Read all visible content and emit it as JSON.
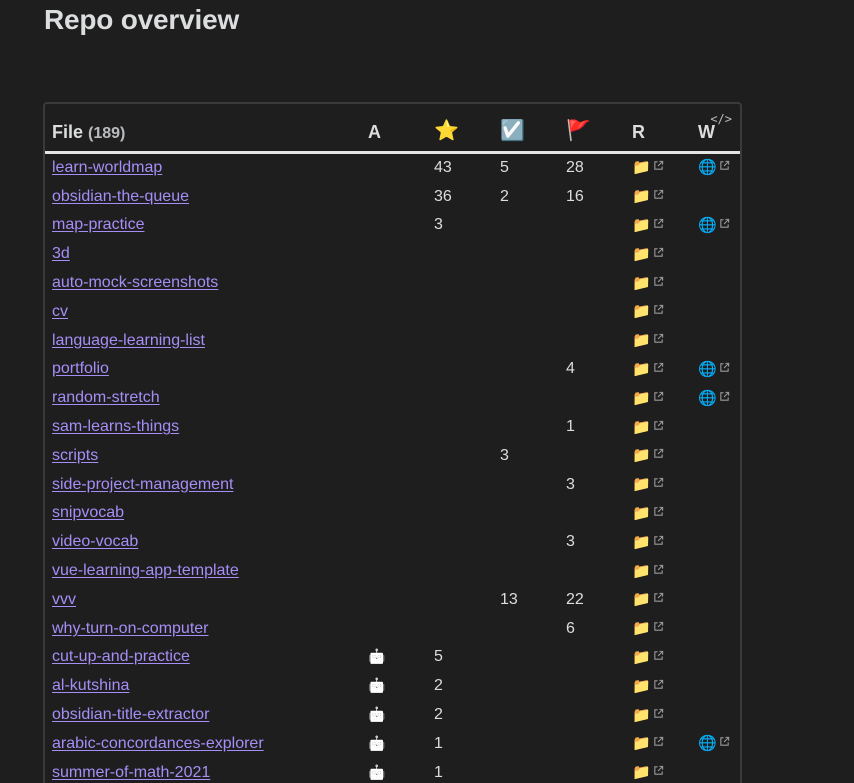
{
  "page": {
    "title": "Repo overview",
    "code_toggle": "</>"
  },
  "table": {
    "headers": {
      "file": "File",
      "file_count": "(189)",
      "archived": "A",
      "stars": "⭐",
      "todos": "☑️",
      "issues": "🚩",
      "repo": "R",
      "website": "W"
    },
    "icons": {
      "folder": "📁",
      "globe": "🌐",
      "bot": "🤖"
    },
    "rows": [
      {
        "name": "learn-worldmap",
        "archived": "",
        "stars": "43",
        "todos": "5",
        "issues": "28",
        "repo": true,
        "web": true
      },
      {
        "name": "obsidian-the-queue",
        "archived": "",
        "stars": "36",
        "todos": "2",
        "issues": "16",
        "repo": true,
        "web": false
      },
      {
        "name": "map-practice",
        "archived": "",
        "stars": "3",
        "todos": "",
        "issues": "",
        "repo": true,
        "web": true
      },
      {
        "name": "3d",
        "archived": "",
        "stars": "",
        "todos": "",
        "issues": "",
        "repo": true,
        "web": false
      },
      {
        "name": "auto-mock-screenshots",
        "archived": "",
        "stars": "",
        "todos": "",
        "issues": "",
        "repo": true,
        "web": false
      },
      {
        "name": "cv",
        "archived": "",
        "stars": "",
        "todos": "",
        "issues": "",
        "repo": true,
        "web": false
      },
      {
        "name": "language-learning-list",
        "archived": "",
        "stars": "",
        "todos": "",
        "issues": "",
        "repo": true,
        "web": false
      },
      {
        "name": "portfolio",
        "archived": "",
        "stars": "",
        "todos": "",
        "issues": "4",
        "repo": true,
        "web": true
      },
      {
        "name": "random-stretch",
        "archived": "",
        "stars": "",
        "todos": "",
        "issues": "",
        "repo": true,
        "web": true
      },
      {
        "name": "sam-learns-things",
        "archived": "",
        "stars": "",
        "todos": "",
        "issues": "1",
        "repo": true,
        "web": false
      },
      {
        "name": "scripts",
        "archived": "",
        "stars": "",
        "todos": "3",
        "issues": "",
        "repo": true,
        "web": false
      },
      {
        "name": "side-project-management",
        "archived": "",
        "stars": "",
        "todos": "",
        "issues": "3",
        "repo": true,
        "web": false
      },
      {
        "name": "snipvocab",
        "archived": "",
        "stars": "",
        "todos": "",
        "issues": "",
        "repo": true,
        "web": false
      },
      {
        "name": "video-vocab",
        "archived": "",
        "stars": "",
        "todos": "",
        "issues": "3",
        "repo": true,
        "web": false
      },
      {
        "name": "vue-learning-app-template",
        "archived": "",
        "stars": "",
        "todos": "",
        "issues": "",
        "repo": true,
        "web": false
      },
      {
        "name": "vvv",
        "archived": "",
        "stars": "",
        "todos": "13",
        "issues": "22",
        "repo": true,
        "web": false
      },
      {
        "name": "why-turn-on-computer",
        "archived": "",
        "stars": "",
        "todos": "",
        "issues": "6",
        "repo": true,
        "web": false
      },
      {
        "name": "cut-up-and-practice",
        "archived": "bot",
        "stars": "5",
        "todos": "",
        "issues": "",
        "repo": true,
        "web": false
      },
      {
        "name": "al-kutshina",
        "archived": "bot",
        "stars": "2",
        "todos": "",
        "issues": "",
        "repo": true,
        "web": false
      },
      {
        "name": "obsidian-title-extractor",
        "archived": "bot",
        "stars": "2",
        "todos": "",
        "issues": "",
        "repo": true,
        "web": false
      },
      {
        "name": "arabic-concordances-explorer",
        "archived": "bot",
        "stars": "1",
        "todos": "",
        "issues": "",
        "repo": true,
        "web": true
      },
      {
        "name": "summer-of-math-2021",
        "archived": "bot",
        "stars": "1",
        "todos": "",
        "issues": "",
        "repo": true,
        "web": false
      }
    ]
  }
}
